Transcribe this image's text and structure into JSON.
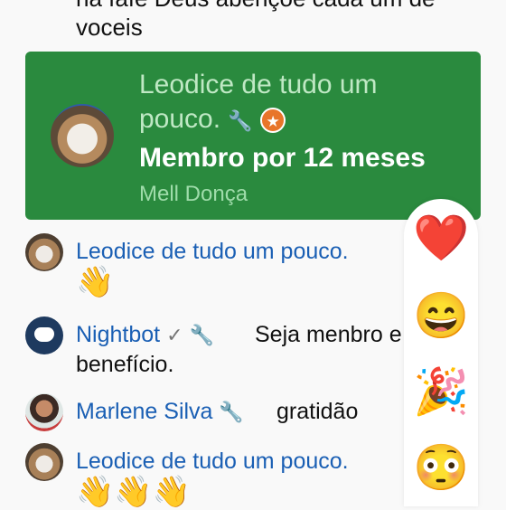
{
  "chat_top_text": "na fafé Deus abençoe cada um de voceis",
  "membership_card": {
    "title": "Leodice de tudo um pouco.",
    "title_icons": [
      "wrench-icon",
      "moderator-badge-icon"
    ],
    "subtitle": "Membro por 12 meses",
    "name": "Mell Donça",
    "background_color": "#2a8a3e"
  },
  "messages": [
    {
      "author": "Leodice de tudo um pouco.",
      "text": "",
      "emoji": "👋",
      "avatar": "dog-avatar"
    },
    {
      "author": "Nightbot",
      "verified_icon": "✓",
      "mod_icon": "🔧",
      "text": "Seja menbro e",
      "text_line2": "benefício.",
      "avatar": "nightbot-avatar"
    },
    {
      "author": "Marlene Silva",
      "mod_icon": "🔧",
      "text": "gratidão",
      "avatar": "marlene-avatar"
    },
    {
      "author": "Leodice de tudo um pouco.",
      "text": "",
      "emoji": "👋👋👋",
      "avatar": "dog-avatar"
    }
  ],
  "reactions": [
    "❤️",
    "😄",
    "🎉",
    "😳"
  ]
}
